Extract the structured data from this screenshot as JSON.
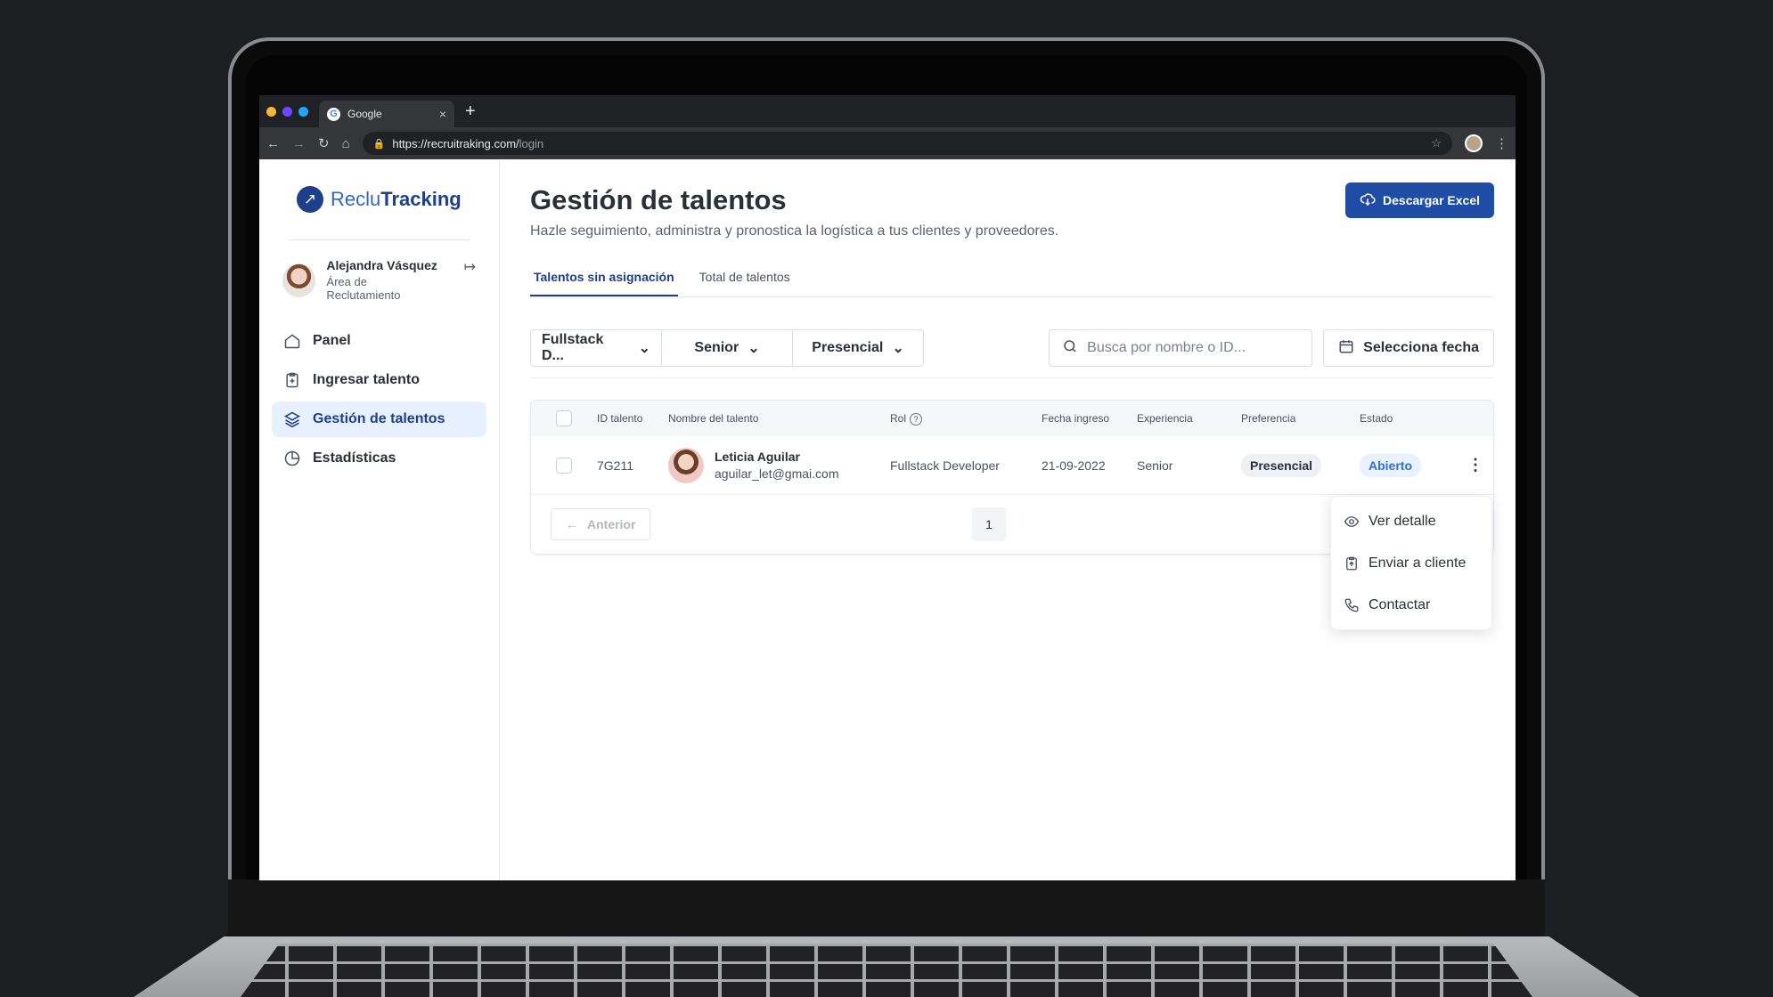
{
  "browser": {
    "tab_title": "Google",
    "tab_icon": "G",
    "tab_close": "×",
    "new_tab": "+",
    "url_base": "https://recruitraking.com/",
    "url_path": "login",
    "colors": {
      "dot1": "#f6b73c",
      "dot2": "#6c47ff",
      "dot3": "#1ea7fd"
    }
  },
  "sidebar": {
    "logo_light": "Reclu",
    "logo_bold": "Tracking",
    "user": {
      "name": "Alejandra Vásquez",
      "role": "Área de Reclutamiento"
    },
    "items": [
      {
        "label": "Panel",
        "icon": "home-icon"
      },
      {
        "label": "Ingresar talento",
        "icon": "clipboard-plus-icon"
      },
      {
        "label": "Gestión de talentos",
        "icon": "layers-icon",
        "active": true
      },
      {
        "label": "Estadísticas",
        "icon": "pie-chart-icon"
      }
    ]
  },
  "header": {
    "title": "Gestión de talentos",
    "subtitle": "Hazle seguimiento, administra y pronostica la logística a tus clientes y proveedores.",
    "download_label": "Descargar Excel"
  },
  "tabs": [
    {
      "label": "Talentos sin asignación",
      "active": true
    },
    {
      "label": "Total de talentos",
      "active": false
    }
  ],
  "filters": {
    "role": "Fullstack D...",
    "experience": "Senior",
    "preference": "Presencial",
    "search_placeholder": "Busca por nombre o ID...",
    "date_label": "Selecciona fecha"
  },
  "table": {
    "columns": [
      "ID talento",
      "Nombre del talento",
      "Rol",
      "Fecha ingreso",
      "Experiencia",
      "Preferencia",
      "Estado"
    ],
    "rows": [
      {
        "id": "7G211",
        "name": "Leticia Aguilar",
        "email": "aguilar_let@gmai.com",
        "role": "Fullstack Developer",
        "date": "21-09-2022",
        "experience": "Senior",
        "preference": "Presencial",
        "status": "Abierto"
      }
    ],
    "prev_label": "Anterior",
    "page": "1"
  },
  "row_menu": {
    "items": [
      {
        "label": "Ver detalle",
        "icon": "eye-icon"
      },
      {
        "label": "Enviar a cliente",
        "icon": "clipboard-send-icon"
      },
      {
        "label": "Contactar",
        "icon": "phone-icon"
      }
    ]
  },
  "accent": "#1f4da6"
}
